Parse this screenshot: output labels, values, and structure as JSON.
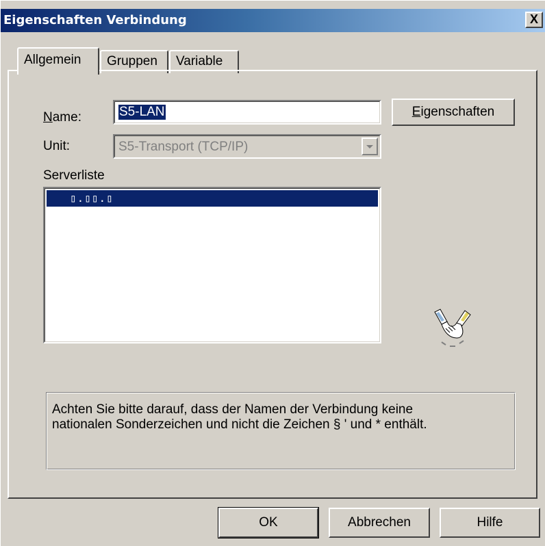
{
  "window": {
    "title": "Eigenschaften Verbindung",
    "close_glyph": "X"
  },
  "tabs": [
    {
      "label": "Allgemein",
      "active": true
    },
    {
      "label": "Gruppen",
      "active": false
    },
    {
      "label": "Variable",
      "active": false
    }
  ],
  "form": {
    "name_label_accel": "N",
    "name_label_rest": "ame:",
    "name_value": "S5-LAN",
    "unit_label": "Unit:",
    "unit_value": "S5-Transport (TCP/IP)",
    "serverlist_label": "Serverliste",
    "serverlist_items": [
      "▯.▯▯.▯"
    ],
    "eigenschaften_accel": "E",
    "eigenschaften_rest": "igenschaften"
  },
  "icon": {
    "name": "handshake-icon"
  },
  "note": {
    "line1": "Achten Sie bitte darauf, dass der Namen der Verbindung keine",
    "line2": "nationalen Sonderzeichen und nicht die Zeichen § ' und * enthält."
  },
  "buttons": {
    "ok": "OK",
    "cancel": "Abbrechen",
    "help": "Hilfe"
  },
  "colors": {
    "face": "#d4d0c8",
    "title_active": "#0a246a",
    "selection": "#0a246a"
  }
}
